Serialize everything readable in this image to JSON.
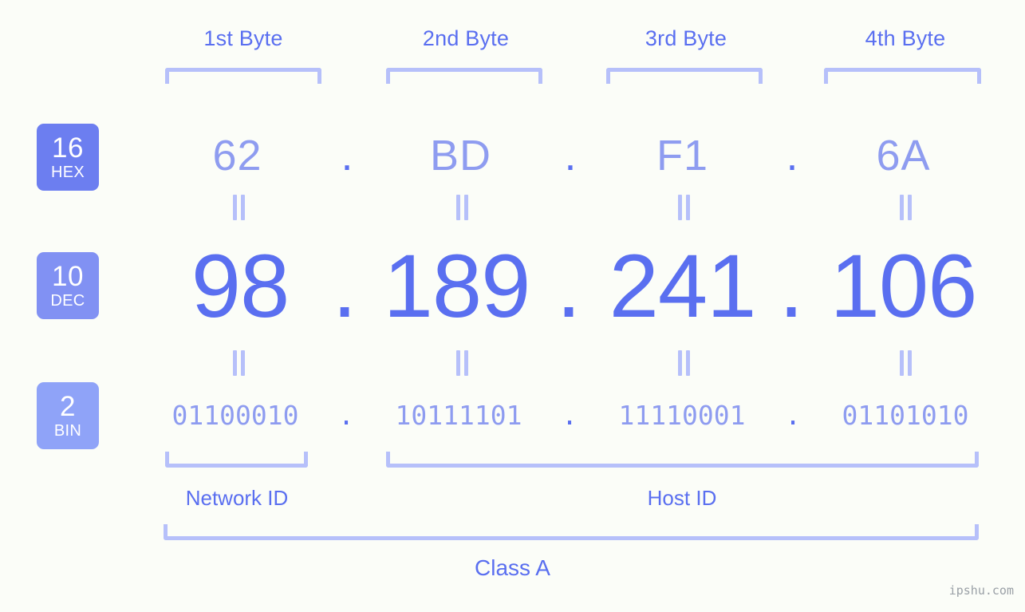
{
  "meta": {
    "background_color": "#fbfdf8",
    "primary_color": "#5a6ff0",
    "secondary_color": "#8e9cf0",
    "bracket_color": "#b6c0fa",
    "watermark": "ipshu.com"
  },
  "header": {
    "byte_labels": [
      "1st Byte",
      "2nd Byte",
      "3rd Byte",
      "4th Byte"
    ]
  },
  "bases": [
    {
      "number": "16",
      "name": "HEX",
      "color": "#6c7ef0"
    },
    {
      "number": "10",
      "name": "DEC",
      "color": "#8191f3"
    },
    {
      "number": "2",
      "name": "BIN",
      "color": "#8fa3f8"
    }
  ],
  "separator": ".",
  "equals_mark": "=",
  "rows": {
    "hex": {
      "label": "HEX",
      "values": [
        "62",
        "BD",
        "F1",
        "6A"
      ]
    },
    "dec": {
      "label": "DEC",
      "values": [
        "98",
        "189",
        "241",
        "106"
      ]
    },
    "bin": {
      "label": "BIN",
      "values": [
        "01100010",
        "10111101",
        "11110001",
        "01101010"
      ]
    }
  },
  "footer": {
    "network_id_label": "Network ID",
    "host_id_label": "Host ID",
    "class_label": "Class A"
  }
}
